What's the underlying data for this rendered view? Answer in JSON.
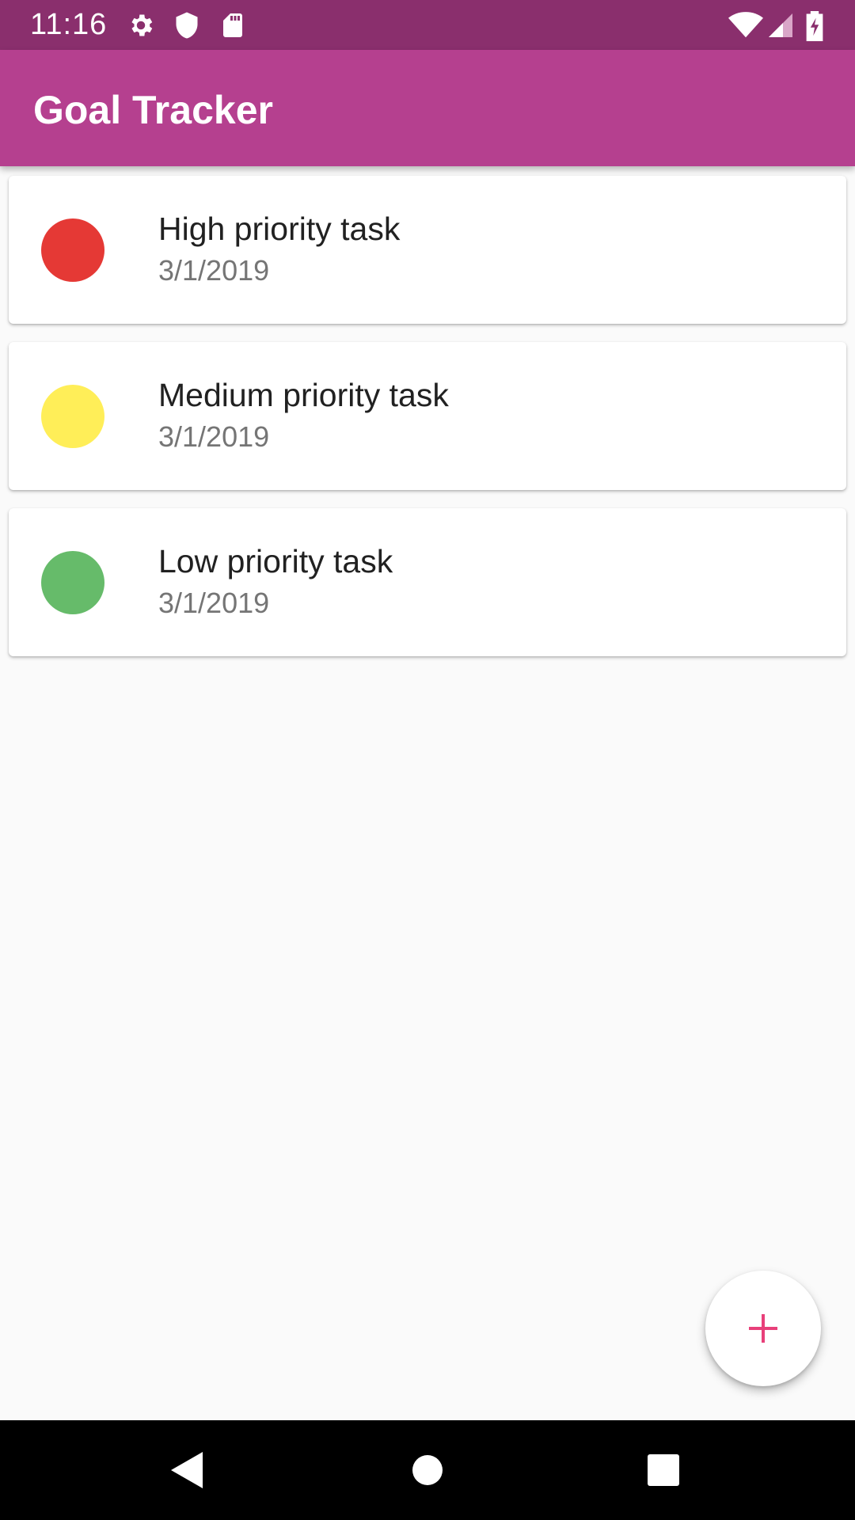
{
  "status_bar": {
    "time": "11:16",
    "left_icons": [
      "settings-gear-icon",
      "shield-icon",
      "sd-card-icon"
    ],
    "right_icons": [
      "wifi-icon",
      "signal-icon",
      "battery-charging-icon"
    ]
  },
  "app_bar": {
    "title": "Goal Tracker",
    "color": "#b5408f",
    "status_color": "#8a2f6d"
  },
  "tasks": [
    {
      "title": "High priority task",
      "date": "3/1/2019",
      "priority_color": "#e53935"
    },
    {
      "title": "Medium priority task",
      "date": "3/1/2019",
      "priority_color": "#ffee58"
    },
    {
      "title": "Low priority task",
      "date": "3/1/2019",
      "priority_color": "#66bb6a"
    }
  ],
  "fab": {
    "icon": "plus-icon",
    "icon_color": "#e8407a"
  },
  "nav_bar": {
    "buttons": [
      "back-icon",
      "home-icon",
      "recents-icon"
    ]
  }
}
